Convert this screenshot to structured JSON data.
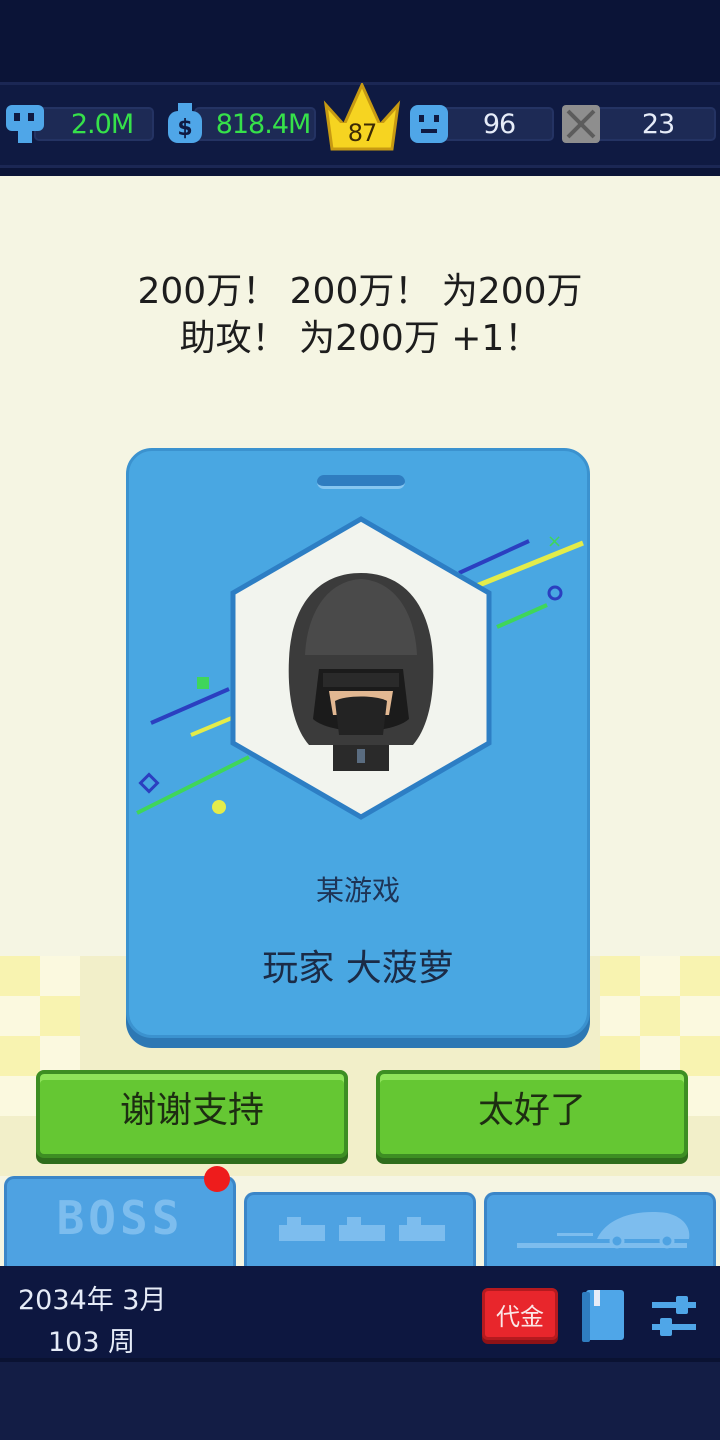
{
  "stats": {
    "fans": "2.0M",
    "money": "818.4M",
    "level": "87",
    "employees": "96",
    "items": "23"
  },
  "headline": {
    "line1": "200万！ 200万！ 为200万",
    "line2": "助攻！ 为200万 +1！"
  },
  "card": {
    "company": "某游戏",
    "player": "玩家 大菠萝"
  },
  "buttons": {
    "thanks": "谢谢支持",
    "great": "太好了"
  },
  "tabs": {
    "boss": "BOSS"
  },
  "footer": {
    "date": "2034年 3月",
    "week": "103 周",
    "voucher": "代金"
  },
  "colors": {
    "accent_green": "#65c733",
    "card_blue": "#49a7e2",
    "stat_green": "#36e14a",
    "notification_red": "#ee1c1c"
  }
}
